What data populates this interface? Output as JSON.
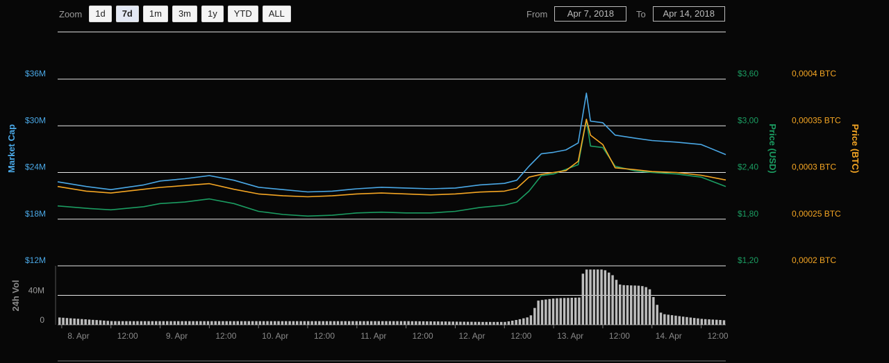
{
  "zoom": {
    "label": "Zoom",
    "buttons": [
      "1d",
      "7d",
      "1m",
      "3m",
      "1y",
      "YTD",
      "ALL"
    ],
    "active": "7d"
  },
  "range": {
    "from_label": "From",
    "from_value": "Apr 7, 2018",
    "to_label": "To",
    "to_value": "Apr 14, 2018"
  },
  "colors": {
    "market_cap": "#4aa8e6",
    "price_usd": "#1b9d62",
    "price_btc": "#f5a623",
    "volume": "#bdbdbd",
    "grid": "#e6e6e6",
    "background": "#070707"
  },
  "chart_data": {
    "type": "line",
    "x_tick_labels": [
      "8. Apr",
      "12:00",
      "9. Apr",
      "12:00",
      "10. Apr",
      "12:00",
      "11. Apr",
      "12:00",
      "12. Apr",
      "12:00",
      "13. Apr",
      "12:00",
      "14. Apr",
      "12:00"
    ],
    "x_range": [
      "2018-04-07T23:00",
      "2018-04-14T18:00"
    ],
    "axes": {
      "market_cap": {
        "label": "Market Cap",
        "ticks": [
          "$12M",
          "$18M",
          "$24M",
          "$30M",
          "$36M"
        ],
        "ylim": [
          12,
          36
        ]
      },
      "price_usd": {
        "label": "Price (USD)",
        "ticks": [
          "$1,20",
          "$1,80",
          "$2,40",
          "$3,00",
          "$3,60"
        ],
        "ylim": [
          1.2,
          3.6
        ]
      },
      "price_btc": {
        "label": "Price (BTC)",
        "ticks": [
          "0,0002 BTC",
          "0,00025 BTC",
          "0,0003 BTC",
          "0,00035 BTC",
          "0,0004 BTC"
        ],
        "ylim": [
          0.0002,
          0.0004
        ]
      },
      "volume": {
        "label": "24h Vol",
        "ticks": [
          "0",
          "40M"
        ],
        "ylim": [
          0,
          80
        ]
      }
    },
    "series": [
      {
        "name": "Market Cap",
        "axis": "market_cap",
        "x": [
          "2018-04-07T23:00",
          "2018-04-08T06:00",
          "2018-04-08T12:00",
          "2018-04-08T20:00",
          "2018-04-09T00:00",
          "2018-04-09T06:00",
          "2018-04-09T12:00",
          "2018-04-09T18:00",
          "2018-04-10T00:00",
          "2018-04-10T06:00",
          "2018-04-10T12:00",
          "2018-04-10T18:00",
          "2018-04-11T00:00",
          "2018-04-11T06:00",
          "2018-04-11T12:00",
          "2018-04-11T18:00",
          "2018-04-12T00:00",
          "2018-04-12T06:00",
          "2018-04-12T12:00",
          "2018-04-12T15:00",
          "2018-04-12T18:00",
          "2018-04-12T21:00",
          "2018-04-13T00:00",
          "2018-04-13T03:00",
          "2018-04-13T06:00",
          "2018-04-13T08:00",
          "2018-04-13T09:00",
          "2018-04-13T12:00",
          "2018-04-13T15:00",
          "2018-04-13T20:00",
          "2018-04-14T00:00",
          "2018-04-14T06:00",
          "2018-04-14T12:00",
          "2018-04-14T18:00"
        ],
        "values": [
          22.8,
          22.2,
          21.8,
          22.4,
          22.9,
          23.2,
          23.6,
          23.0,
          22.1,
          21.8,
          21.5,
          21.6,
          21.9,
          22.1,
          22.0,
          21.9,
          22.0,
          22.4,
          22.6,
          23.0,
          24.8,
          26.4,
          26.6,
          26.9,
          27.8,
          34.2,
          30.6,
          30.4,
          28.8,
          28.4,
          28.1,
          27.9,
          27.6,
          26.3
        ]
      },
      {
        "name": "Price (USD)",
        "axis": "price_usd",
        "x": [
          "2018-04-07T23:00",
          "2018-04-08T06:00",
          "2018-04-08T12:00",
          "2018-04-08T20:00",
          "2018-04-09T00:00",
          "2018-04-09T06:00",
          "2018-04-09T12:00",
          "2018-04-09T18:00",
          "2018-04-10T00:00",
          "2018-04-10T06:00",
          "2018-04-10T12:00",
          "2018-04-10T18:00",
          "2018-04-11T00:00",
          "2018-04-11T06:00",
          "2018-04-11T12:00",
          "2018-04-11T18:00",
          "2018-04-12T00:00",
          "2018-04-12T06:00",
          "2018-04-12T12:00",
          "2018-04-12T15:00",
          "2018-04-12T18:00",
          "2018-04-12T21:00",
          "2018-04-13T00:00",
          "2018-04-13T03:00",
          "2018-04-13T06:00",
          "2018-04-13T08:00",
          "2018-04-13T09:00",
          "2018-04-13T12:00",
          "2018-04-13T15:00",
          "2018-04-13T20:00",
          "2018-04-14T00:00",
          "2018-04-14T06:00",
          "2018-04-14T12:00",
          "2018-04-14T18:00"
        ],
        "values": [
          1.97,
          1.94,
          1.92,
          1.96,
          2.0,
          2.02,
          2.06,
          2.0,
          1.9,
          1.86,
          1.84,
          1.85,
          1.88,
          1.89,
          1.88,
          1.88,
          1.9,
          1.95,
          1.98,
          2.02,
          2.16,
          2.36,
          2.38,
          2.44,
          2.5,
          3.08,
          2.74,
          2.72,
          2.48,
          2.42,
          2.4,
          2.38,
          2.34,
          2.22
        ]
      },
      {
        "name": "Price (BTC)",
        "axis": "price_btc",
        "x": [
          "2018-04-07T23:00",
          "2018-04-08T06:00",
          "2018-04-08T12:00",
          "2018-04-08T20:00",
          "2018-04-09T00:00",
          "2018-04-09T06:00",
          "2018-04-09T12:00",
          "2018-04-09T18:00",
          "2018-04-10T00:00",
          "2018-04-10T06:00",
          "2018-04-10T12:00",
          "2018-04-10T18:00",
          "2018-04-11T00:00",
          "2018-04-11T06:00",
          "2018-04-11T12:00",
          "2018-04-11T18:00",
          "2018-04-12T00:00",
          "2018-04-12T06:00",
          "2018-04-12T12:00",
          "2018-04-12T15:00",
          "2018-04-12T18:00",
          "2018-04-12T21:00",
          "2018-04-13T00:00",
          "2018-04-13T03:00",
          "2018-04-13T06:00",
          "2018-04-13T08:00",
          "2018-04-13T09:00",
          "2018-04-13T12:00",
          "2018-04-13T15:00",
          "2018-04-13T20:00",
          "2018-04-14T00:00",
          "2018-04-14T06:00",
          "2018-04-14T12:00",
          "2018-04-14T18:00"
        ],
        "values": [
          0.000285,
          0.00028,
          0.000278,
          0.000282,
          0.000284,
          0.000286,
          0.000288,
          0.000282,
          0.000277,
          0.000275,
          0.000274,
          0.000275,
          0.000277,
          0.000278,
          0.000277,
          0.000276,
          0.000277,
          0.000279,
          0.00028,
          0.000283,
          0.000295,
          0.000298,
          0.0003,
          0.000302,
          0.000312,
          0.000357,
          0.00034,
          0.00033,
          0.000305,
          0.000303,
          0.000301,
          0.0003,
          0.000297,
          0.000292
        ]
      },
      {
        "name": "24h Vol",
        "axis": "volume",
        "type": "column",
        "x": [
          "2018-04-07T23:00",
          "2018-04-08T12:00",
          "2018-04-09T12:00",
          "2018-04-10T12:00",
          "2018-04-11T12:00",
          "2018-04-12T06:00",
          "2018-04-12T12:00",
          "2018-04-12T15:00",
          "2018-04-12T18:00",
          "2018-04-12T20:00",
          "2018-04-13T00:00",
          "2018-04-13T06:00",
          "2018-04-13T07:00",
          "2018-04-13T12:00",
          "2018-04-13T14:00",
          "2018-04-13T16:00",
          "2018-04-13T21:00",
          "2018-04-13T23:00",
          "2018-04-14T02:00",
          "2018-04-14T06:00",
          "2018-04-14T12:00",
          "2018-04-14T18:00"
        ],
        "values": [
          10,
          5,
          5,
          5,
          5,
          4,
          4,
          7,
          11,
          33,
          36,
          37,
          75,
          75,
          68,
          54,
          53,
          50,
          15,
          12,
          8,
          6
        ]
      }
    ]
  }
}
